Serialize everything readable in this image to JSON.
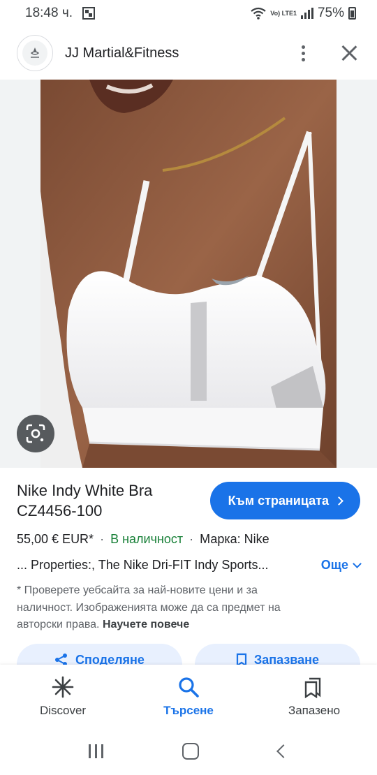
{
  "status_bar": {
    "time": "18:48 ч.",
    "volte": "Vo) LTE1",
    "battery": "75%"
  },
  "header": {
    "site_name": "JJ Martial&Fitness",
    "avatar_icon": "jj-logo-icon",
    "more_icon": "more-vert-icon",
    "close_icon": "close-icon"
  },
  "product": {
    "title": "Nike Indy White Bra CZ4456-100",
    "visit_button": "Към страницата",
    "price": "55,00 € EUR*",
    "separator": "·",
    "stock": "В наличност",
    "brand": "Марка: Nike",
    "description": "... Properties:, The Nike Dri-FIT Indy Sports...",
    "more_link": "Още",
    "disclaimer": "* Проверете уебсайта за най-новите цени и за наличност. Изображенията може да са предмет на авторски права.",
    "learn_more": "Научете повече"
  },
  "actions": {
    "share": "Споделяне",
    "save": "Запазване"
  },
  "bottom_nav": [
    {
      "label": "Discover",
      "icon": "discover-icon",
      "active": false
    },
    {
      "label": "Търсене",
      "icon": "search-icon",
      "active": true
    },
    {
      "label": "Запазено",
      "icon": "saved-icon",
      "active": false
    }
  ],
  "colors": {
    "accent": "#1a73e8",
    "stock_green": "#188038",
    "image_background": "#f1f3f4"
  }
}
